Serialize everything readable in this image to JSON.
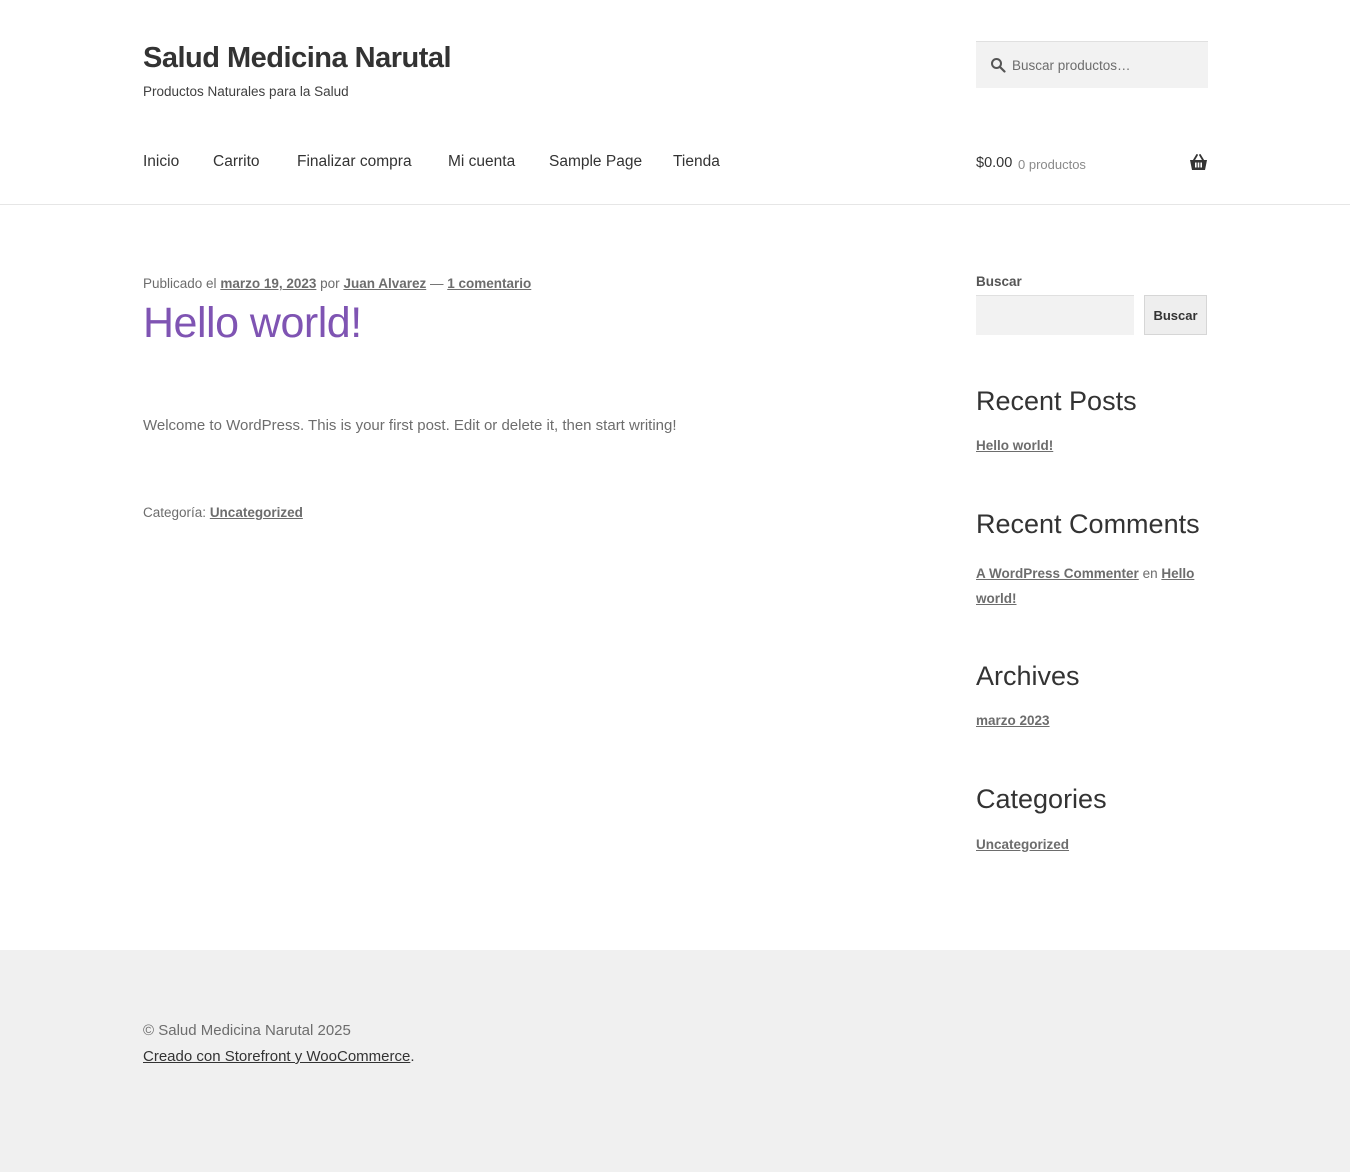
{
  "header": {
    "site_title": "Salud Medicina Narutal",
    "site_description": "Productos Naturales para la Salud",
    "search_placeholder": "Buscar productos…"
  },
  "nav": {
    "items": [
      {
        "label": "Inicio"
      },
      {
        "label": "Carrito"
      },
      {
        "label": "Finalizar compra"
      },
      {
        "label": "Mi cuenta"
      },
      {
        "label": "Sample Page"
      },
      {
        "label": "Tienda"
      }
    ]
  },
  "cart": {
    "amount": "$0.00",
    "count": "0 productos",
    "icon": "basket-icon"
  },
  "post": {
    "meta_prefix": "Publicado el",
    "date": "marzo 19, 2023",
    "by": "por",
    "author": "Juan Alvarez",
    "separator": "—",
    "comments": "1 comentario",
    "title": "Hello world!",
    "body": "Welcome to WordPress. This is your first post. Edit or delete it, then start writing!",
    "category_label": "Categoría:",
    "category": "Uncategorized"
  },
  "sidebar": {
    "search_label": "Buscar",
    "search_button": "Buscar",
    "recent_posts_title": "Recent Posts",
    "recent_posts": [
      "Hello world!"
    ],
    "recent_comments_title": "Recent Comments",
    "comment_author": "A WordPress Commenter",
    "comment_on": "en",
    "comment_post": "Hello world!",
    "archives_title": "Archives",
    "archives": [
      "marzo 2023"
    ],
    "categories_title": "Categories",
    "categories": [
      "Uncategorized"
    ]
  },
  "footer": {
    "copyright": "© Salud Medicina Narutal 2025",
    "credit": "Creado con Storefront y WooCommerce",
    "credit_suffix": "."
  },
  "colors": {
    "accent": "#7f54b3",
    "text": "#43454b",
    "muted": "#6d6d6d",
    "footer_bg": "#f0f0f0"
  }
}
